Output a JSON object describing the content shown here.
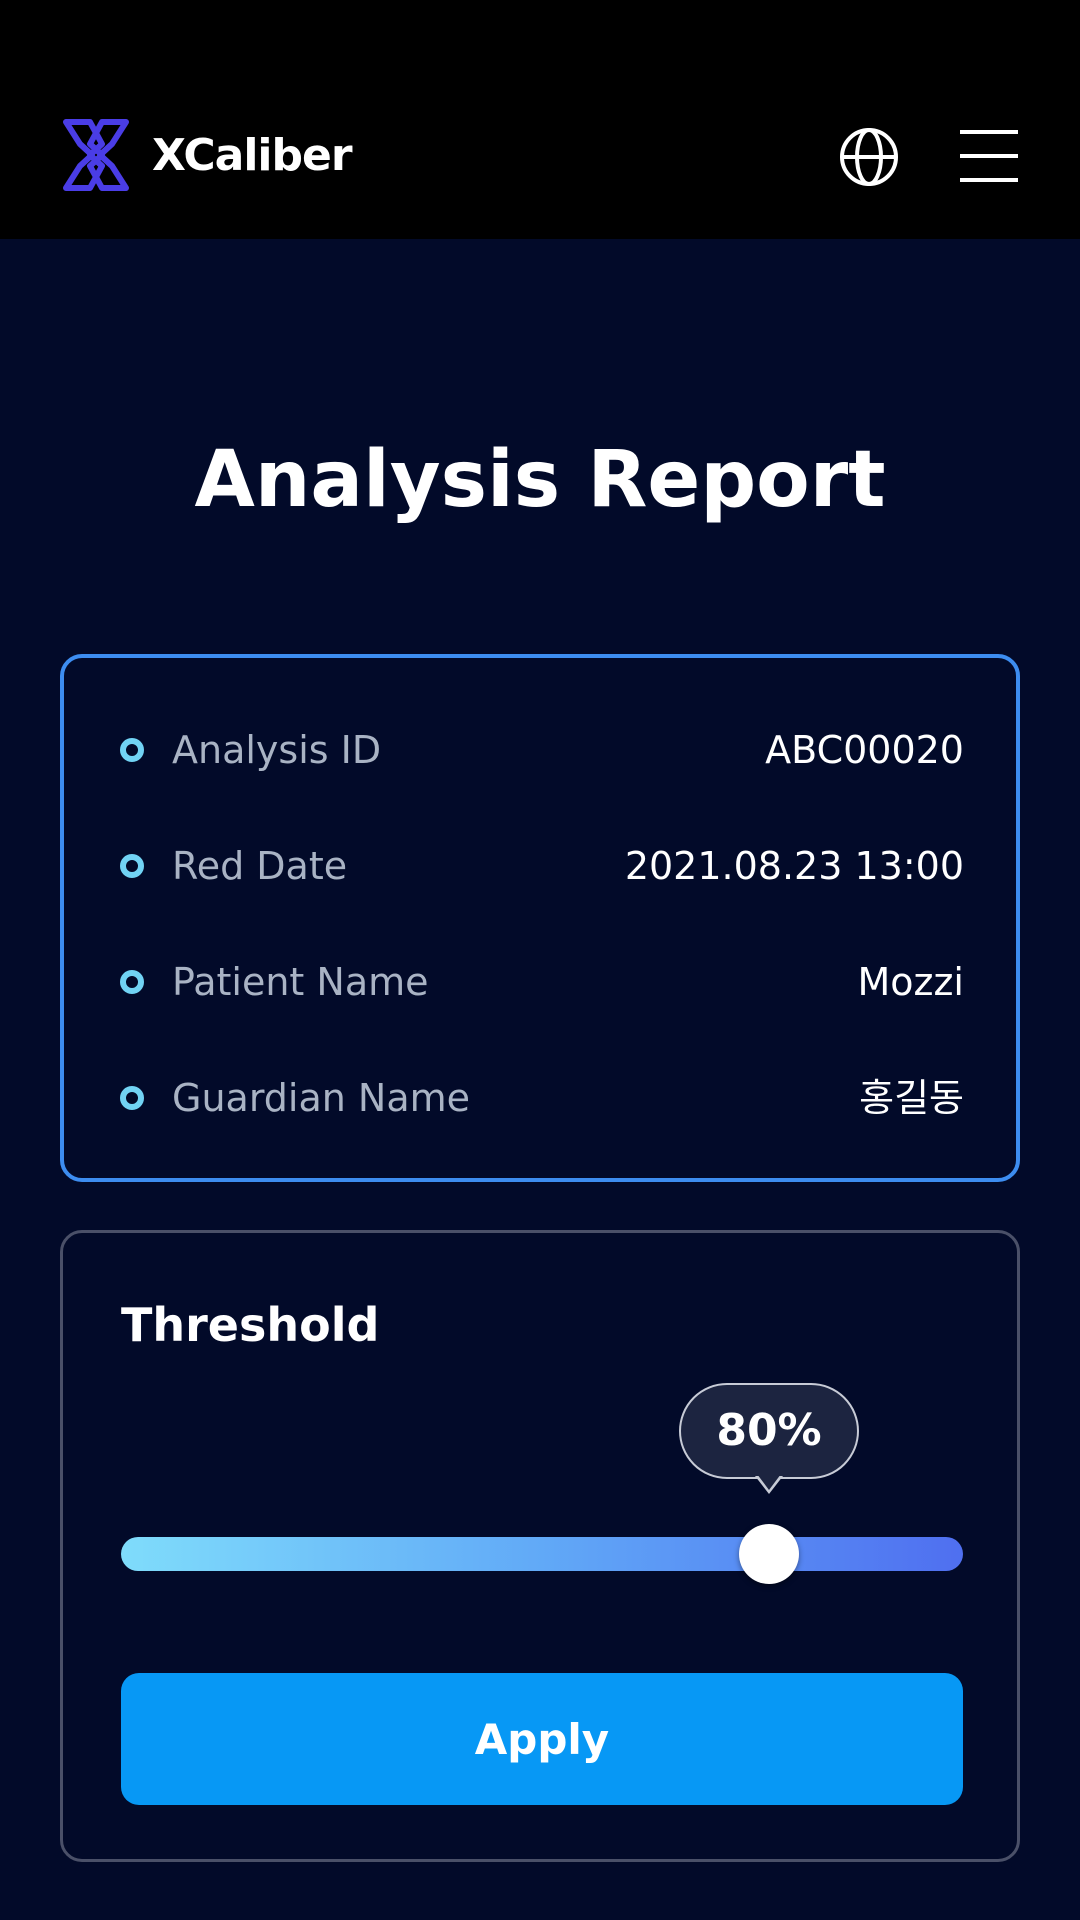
{
  "header": {
    "brand": "XCaliber",
    "logo_icon": "xcaliber-logo-icon",
    "language_icon": "globe-icon",
    "menu_icon": "hamburger-menu-icon",
    "colors": {
      "background": "#000000",
      "logo": "#4a3de6"
    }
  },
  "page": {
    "title": "Analysis Report",
    "background": "#020a29"
  },
  "info": {
    "border_color": "#3d8df0",
    "bullet_color": "#71d3f4",
    "rows": [
      {
        "label": "Analysis ID",
        "value": "ABC00020"
      },
      {
        "label": "Red Date",
        "value": "2021.08.23 13:00"
      },
      {
        "label": "Patient Name",
        "value": "Mozzi"
      },
      {
        "label": "Guardian Name",
        "value": "홍길동"
      }
    ]
  },
  "threshold": {
    "title": "Threshold",
    "value_label": "80%",
    "value_percent": 77,
    "apply_label": "Apply",
    "button_color": "#0798f5"
  }
}
